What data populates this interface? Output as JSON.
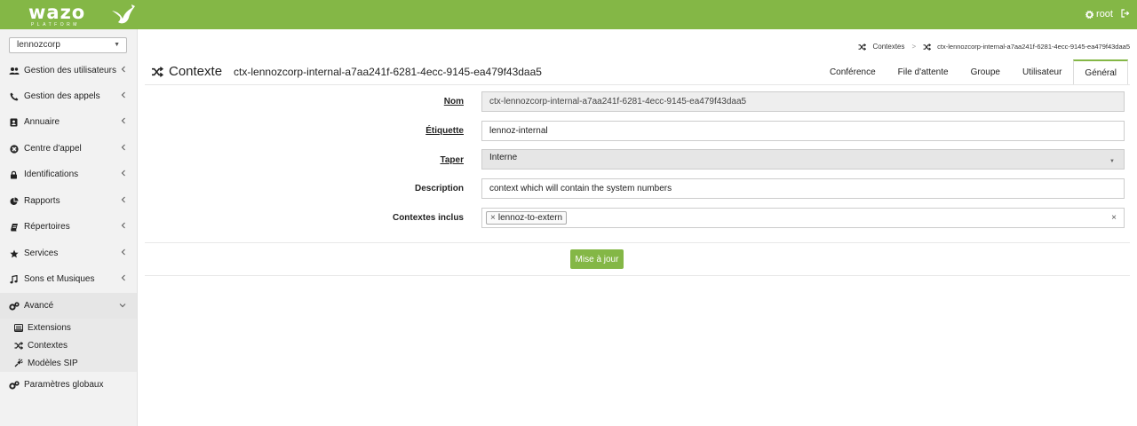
{
  "header": {
    "logo_text": "wazo",
    "logo_sub": "PLATFORM",
    "user": "root"
  },
  "sidebar": {
    "org_select": "lennozcorp",
    "items": [
      {
        "label": "Gestion des utilisateurs",
        "icon": "users-icon"
      },
      {
        "label": "Gestion des appels",
        "icon": "phone-icon"
      },
      {
        "label": "Annuaire",
        "icon": "address-book-icon"
      },
      {
        "label": "Centre d'appel",
        "icon": "lifebuoy-icon"
      },
      {
        "label": "Identifications",
        "icon": "lock-icon"
      },
      {
        "label": "Rapports",
        "icon": "pie-chart-icon"
      },
      {
        "label": "Répertoires",
        "icon": "book-icon"
      },
      {
        "label": "Services",
        "icon": "star-icon"
      },
      {
        "label": "Sons et Musiques",
        "icon": "music-icon"
      },
      {
        "label": "Avancé",
        "icon": "cogs-icon"
      }
    ],
    "sub_items": [
      {
        "label": "Extensions",
        "icon": "extensions-icon"
      },
      {
        "label": "Contextes",
        "icon": "shuffle-icon"
      },
      {
        "label": "Modèles SIP",
        "icon": "plug-icon"
      }
    ],
    "bottom_item": {
      "label": "Paramètres globaux",
      "icon": "cogs-icon"
    }
  },
  "breadcrumb": {
    "parent": "Contextes",
    "current": "ctx-lennozcorp-internal-a7aa241f-6281-4ecc-9145-ea479f43daa5"
  },
  "page": {
    "title": "Contexte",
    "subtitle": "ctx-lennozcorp-internal-a7aa241f-6281-4ecc-9145-ea479f43daa5"
  },
  "tabs": [
    "Conférence",
    "File d'attente",
    "Groupe",
    "Utilisateur",
    "Général"
  ],
  "active_tab": "Général",
  "form": {
    "nom_label": "Nom",
    "nom_value": "ctx-lennozcorp-internal-a7aa241f-6281-4ecc-9145-ea479f43daa5",
    "etiquette_label": "Étiquette",
    "etiquette_value": "lennoz-internal",
    "taper_label": "Taper",
    "taper_value": "Interne",
    "description_label": "Description",
    "description_value": "context which will contain the system numbers",
    "contextes_label": "Contextes inclus",
    "contextes_tags": [
      "lennoz-to-extern"
    ],
    "submit_label": "Mise à jour"
  },
  "colors": {
    "brand": "#84b746",
    "sidebar_bg": "#f2f2f2"
  }
}
